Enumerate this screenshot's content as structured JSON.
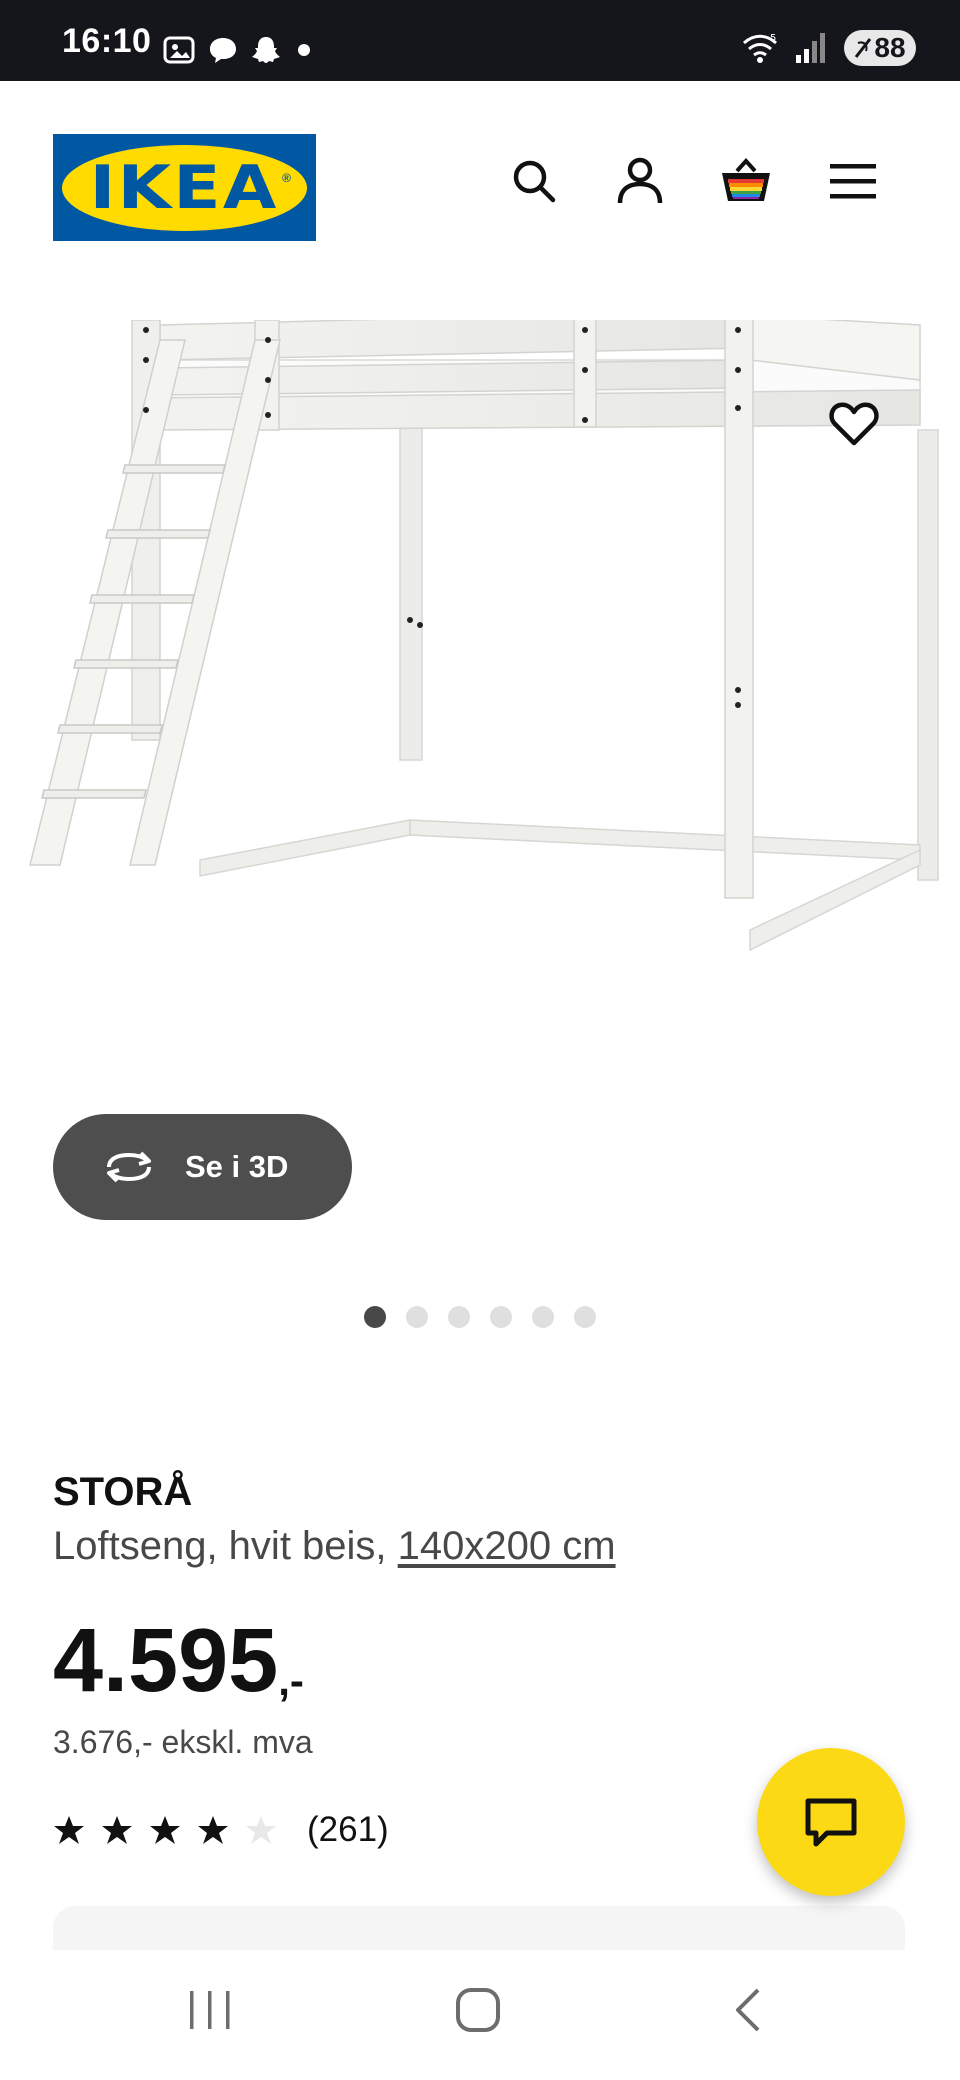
{
  "status_bar": {
    "time": "16:10",
    "battery": "88",
    "icons": [
      "screenshot-icon",
      "chat-bubble-icon",
      "snapchat-icon",
      "dot-icon",
      "wifi-icon",
      "signal-icon",
      "battery-icon"
    ]
  },
  "header": {
    "logo_text": "IKEA",
    "logo_colors": {
      "background": "#0058a3",
      "oval": "#ffdb00"
    },
    "icons": [
      "search-icon",
      "account-icon",
      "cart-icon",
      "menu-icon"
    ]
  },
  "gallery": {
    "view_3d_label": "Se i 3D",
    "dot_count": 6,
    "active_dot": 0
  },
  "product": {
    "name": "STORÅ",
    "description": "Loftseng, hvit beis, ",
    "size": "140x200 cm",
    "price": "4.595",
    "price_suffix": ",-",
    "price_ex_vat": "3.676,- ekskl. mva",
    "rating": 4,
    "rating_max": 5,
    "review_count": "(261)"
  },
  "colors": {
    "accent_yellow": "#fbd914",
    "dark": "#111111",
    "button_gray": "#4e4e4e"
  }
}
